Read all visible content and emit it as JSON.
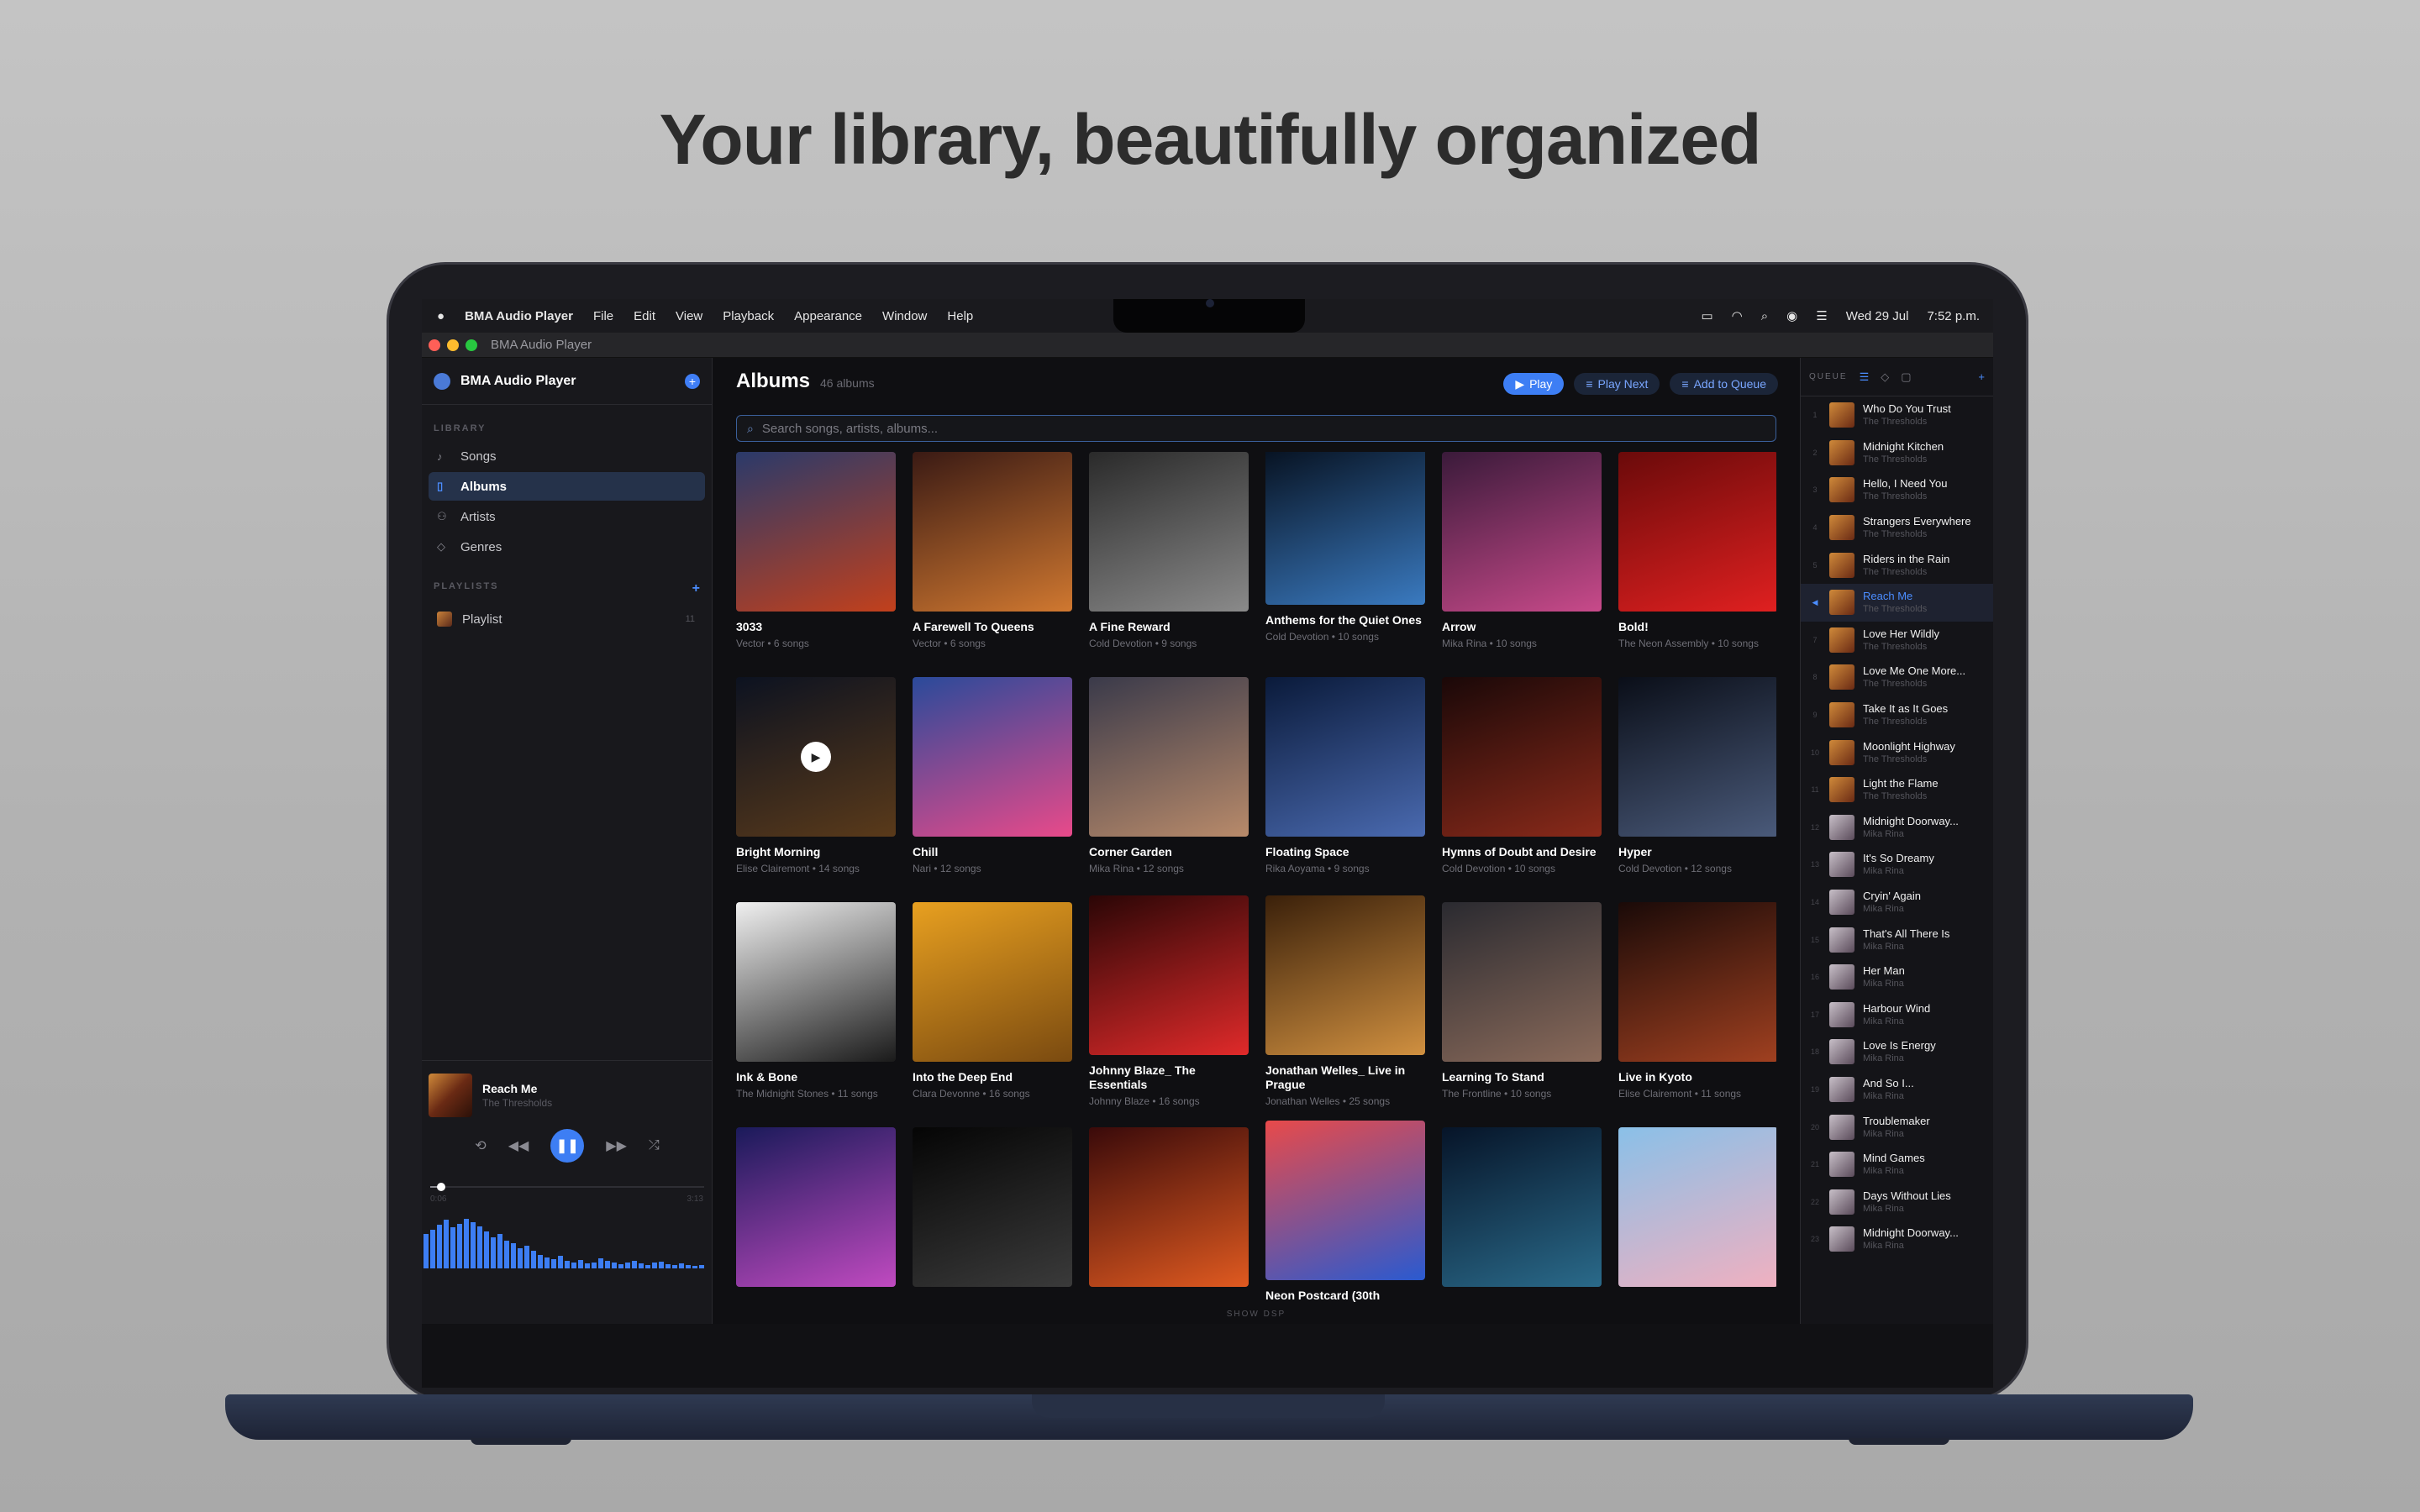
{
  "headline": "Your library, beautifully organized",
  "menubar": {
    "app": "BMA Audio Player",
    "items": [
      "File",
      "Edit",
      "View",
      "Playback",
      "Appearance",
      "Window",
      "Help"
    ],
    "status": {
      "date": "Wed 29 Jul",
      "time": "7:52 p.m."
    }
  },
  "window": {
    "title": "BMA Audio Player"
  },
  "sidebar": {
    "app_name": "BMA Audio Player",
    "library_label": "LIBRARY",
    "items": [
      {
        "label": "Songs",
        "icon": "music-note-icon"
      },
      {
        "label": "Albums",
        "icon": "album-icon",
        "active": true
      },
      {
        "label": "Artists",
        "icon": "artists-icon"
      },
      {
        "label": "Genres",
        "icon": "tag-icon"
      }
    ],
    "playlists_label": "PLAYLISTS",
    "playlists": [
      {
        "label": "Playlist",
        "count": "11"
      }
    ]
  },
  "now_playing": {
    "title": "Reach Me",
    "artist": "The Thresholds",
    "elapsed": "0:06",
    "duration": "3:13",
    "progress": 0.04
  },
  "main": {
    "title": "Albums",
    "count": "46 albums",
    "play_label": "Play",
    "play_next_label": "Play Next",
    "add_queue_label": "Add to Queue",
    "search_placeholder": "Search songs, artists, albums...",
    "show_dsp": "SHOW DSP"
  },
  "albums": [
    {
      "title": "3033",
      "sub": "Vector • 6 songs",
      "c1": "#2a3a6a",
      "c2": "#c2401c"
    },
    {
      "title": "A Farewell To Queens",
      "sub": "Vector • 6 songs",
      "c1": "#3a1a14",
      "c2": "#d07830"
    },
    {
      "title": "A Fine Reward",
      "sub": "Cold Devotion • 9 songs",
      "c1": "#2a2a2a",
      "c2": "#8a8a8a"
    },
    {
      "title": "Anthems for the Quiet Ones",
      "sub": "Cold Devotion • 10 songs",
      "c1": "#06101e",
      "c2": "#3a7ac0"
    },
    {
      "title": "Arrow",
      "sub": "Mika Rina • 10 songs",
      "c1": "#3a1a3a",
      "c2": "#c84a8a"
    },
    {
      "title": "Bold!",
      "sub": "The Neon Assembly • 10 songs",
      "c1": "#6a0a0a",
      "c2": "#e02020"
    },
    {
      "title": "Bright Morning",
      "sub": "Elise Clairemont • 14 songs",
      "c1": "#0c1220",
      "c2": "#5a3a1a"
    },
    {
      "title": "Chill",
      "sub": "Nari • 12 songs",
      "c1": "#2a4a9a",
      "c2": "#e84a8a"
    },
    {
      "title": "Corner Garden",
      "sub": "Mika Rina • 12 songs",
      "c1": "#3a3a4a",
      "c2": "#b88a6a"
    },
    {
      "title": "Floating Space",
      "sub": "Rika Aoyama • 9 songs",
      "c1": "#0a1a3a",
      "c2": "#4a6ab0"
    },
    {
      "title": "Hymns of Doubt and Desire",
      "sub": "Cold Devotion • 10 songs",
      "c1": "#1a0808",
      "c2": "#8a2a1a"
    },
    {
      "title": "Hyper",
      "sub": "Cold Devotion • 12 songs",
      "c1": "#0a0e18",
      "c2": "#4a5a7a"
    },
    {
      "title": "Ink & Bone",
      "sub": "The Midnight Stones • 11 songs",
      "c1": "#f0f0f0",
      "c2": "#1a1a1a"
    },
    {
      "title": "Into the Deep End",
      "sub": "Clara Devonne • 16 songs",
      "c1": "#e8a020",
      "c2": "#7a4a10"
    },
    {
      "title": "Johnny Blaze_ The Essentials",
      "sub": "Johnny Blaze • 16 songs",
      "c1": "#2a0606",
      "c2": "#e02a2a"
    },
    {
      "title": "Jonathan Welles_ Live in Prague",
      "sub": "Jonathan Welles • 25 songs",
      "c1": "#3a200a",
      "c2": "#d09040"
    },
    {
      "title": "Learning To Stand",
      "sub": "The Frontline • 10 songs",
      "c1": "#2a2a30",
      "c2": "#8a6a5a"
    },
    {
      "title": "Live in Kyoto",
      "sub": "Elise Clairemont • 11 songs",
      "c1": "#1a0a08",
      "c2": "#a04020"
    },
    {
      "title": "",
      "sub": "",
      "c1": "#1a1a5a",
      "c2": "#c04ac0"
    },
    {
      "title": "",
      "sub": "",
      "c1": "#050505",
      "c2": "#3a3a3a"
    },
    {
      "title": "",
      "sub": "",
      "c1": "#3a0a0a",
      "c2": "#e05a20"
    },
    {
      "title": "Neon Postcard (30th",
      "sub": "",
      "c1": "#e84a4a",
      "c2": "#2a5ad0"
    },
    {
      "title": "",
      "sub": "",
      "c1": "#061428",
      "c2": "#2a6a8a"
    },
    {
      "title": "",
      "sub": "",
      "c1": "#8ac0e8",
      "c2": "#f0b0c0"
    }
  ],
  "queue": {
    "label": "QUEUE",
    "items": [
      {
        "n": "1",
        "title": "Who Do You Trust",
        "artist": "The Thresholds"
      },
      {
        "n": "2",
        "title": "Midnight Kitchen",
        "artist": "The Thresholds"
      },
      {
        "n": "3",
        "title": "Hello, I Need You",
        "artist": "The Thresholds"
      },
      {
        "n": "4",
        "title": "Strangers Everywhere",
        "artist": "The Thresholds"
      },
      {
        "n": "5",
        "title": "Riders in the Rain",
        "artist": "The Thresholds"
      },
      {
        "n": "◀",
        "title": "Reach Me",
        "artist": "The Thresholds",
        "active": true
      },
      {
        "n": "7",
        "title": "Love Her Wildly",
        "artist": "The Thresholds"
      },
      {
        "n": "8",
        "title": "Love Me One More...",
        "artist": "The Thresholds"
      },
      {
        "n": "9",
        "title": "Take It as It Goes",
        "artist": "The Thresholds"
      },
      {
        "n": "10",
        "title": "Moonlight Highway",
        "artist": "The Thresholds"
      },
      {
        "n": "11",
        "title": "Light the Flame",
        "artist": "The Thresholds"
      },
      {
        "n": "12",
        "title": "Midnight Doorway...",
        "artist": "Mika Rina"
      },
      {
        "n": "13",
        "title": "It's So Dreamy",
        "artist": "Mika Rina"
      },
      {
        "n": "14",
        "title": "Cryin' Again",
        "artist": "Mika Rina"
      },
      {
        "n": "15",
        "title": "That's All There Is",
        "artist": "Mika Rina"
      },
      {
        "n": "16",
        "title": "Her Man",
        "artist": "Mika Rina"
      },
      {
        "n": "17",
        "title": "Harbour Wind",
        "artist": "Mika Rina"
      },
      {
        "n": "18",
        "title": "Love Is Energy",
        "artist": "Mika Rina"
      },
      {
        "n": "19",
        "title": "And So I...",
        "artist": "Mika Rina"
      },
      {
        "n": "20",
        "title": "Troublemaker",
        "artist": "Mika Rina"
      },
      {
        "n": "21",
        "title": "Mind Games",
        "artist": "Mika Rina"
      },
      {
        "n": "22",
        "title": "Days Without Lies",
        "artist": "Mika Rina"
      },
      {
        "n": "23",
        "title": "Midnight Doorway...",
        "artist": "Mika Rina"
      }
    ]
  },
  "visualizer_levels": [
    0.55,
    0.62,
    0.7,
    0.78,
    0.66,
    0.72,
    0.8,
    0.74,
    0.68,
    0.6,
    0.5,
    0.55,
    0.45,
    0.4,
    0.32,
    0.36,
    0.28,
    0.22,
    0.18,
    0.15,
    0.2,
    0.12,
    0.1,
    0.14,
    0.08,
    0.1,
    0.16,
    0.12,
    0.09,
    0.07,
    0.1,
    0.12,
    0.08,
    0.06,
    0.09,
    0.11,
    0.07,
    0.05,
    0.08,
    0.06,
    0.04,
    0.05
  ]
}
